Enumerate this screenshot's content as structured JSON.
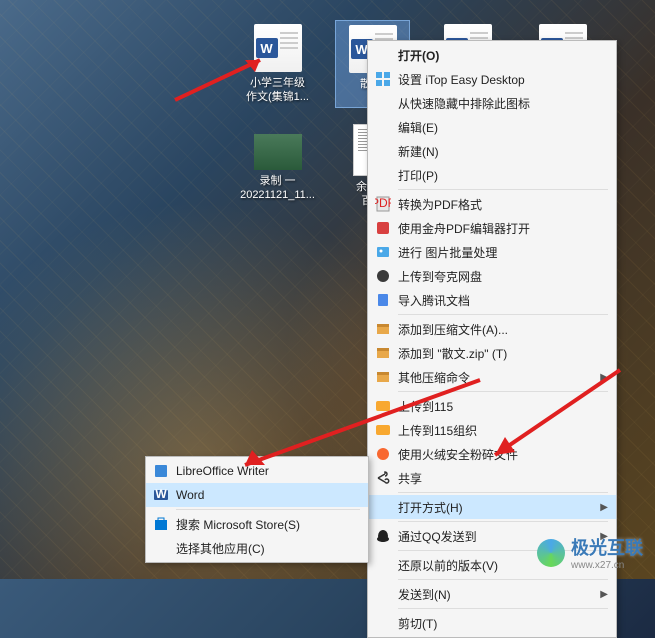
{
  "desktop": {
    "icons_row1": [
      {
        "label": "小学三年级\n作文(集锦1...",
        "type": "word"
      },
      {
        "label": "散文.",
        "type": "word",
        "selected": true
      },
      {
        "label": "",
        "type": "word"
      },
      {
        "label": "",
        "type": "word"
      }
    ],
    "icons_row2": [
      {
        "label": "录制 一\n20221121_11...",
        "type": "video"
      },
      {
        "label": "余光中\n百科",
        "type": "doc"
      }
    ]
  },
  "context_menu": {
    "open": "打开(O)",
    "itop": "设置 iTop Easy Desktop",
    "quick_hide": "从快速隐藏中排除此图标",
    "edit": "编辑(E)",
    "new": "新建(N)",
    "print": "打印(P)",
    "to_pdf": "转换为PDF格式",
    "jinzhou": "使用金舟PDF编辑器打开",
    "batch_img": "进行 图片批量处理",
    "kuake": "上传到夸克网盘",
    "tencent": "导入腾讯文档",
    "compress_a": "添加到压缩文件(A)...",
    "compress_zip": "添加到 \"散文.zip\" (T)",
    "other_compress": "其他压缩命令",
    "upload_115": "上传到115",
    "upload_115_org": "上传到115组织",
    "huorong": "使用火绒安全粉碎文件",
    "share": "共享",
    "open_with": "打开方式(H)",
    "qq_send": "通过QQ发送到",
    "restore_prev": "还原以前的版本(V)",
    "send_to": "发送到(N)",
    "cut": "剪切(T)"
  },
  "submenu": {
    "libreoffice": "LibreOffice Writer",
    "word": "Word",
    "search_store": "搜索 Microsoft Store(S)",
    "choose_other": "选择其他应用(C)"
  },
  "watermark": {
    "text": "极光互联",
    "url": "www.x27.cn"
  }
}
